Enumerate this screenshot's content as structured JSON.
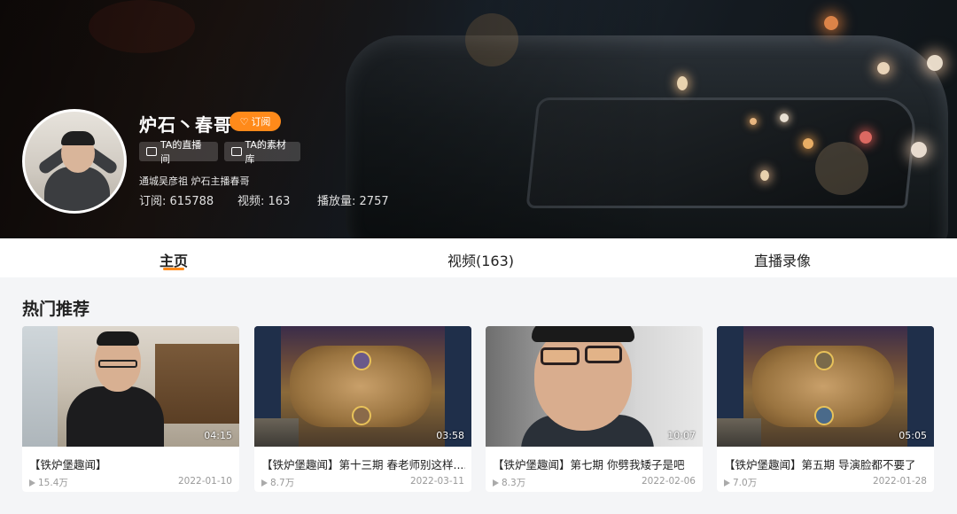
{
  "profile": {
    "name": "炉石丶春哥",
    "subscribe_label": "订阅",
    "live_room_label": "TA的直播间",
    "material_label": "TA的素材库",
    "description": "通城吴彦祖 炉石主播春哥",
    "stats": [
      {
        "label": "订阅:",
        "value": "615788"
      },
      {
        "label": "视频:",
        "value": "163"
      },
      {
        "label": "播放量:",
        "value": "2757"
      }
    ]
  },
  "tabs": [
    {
      "label": "主页",
      "active": true
    },
    {
      "label": "视频(163)",
      "active": false
    },
    {
      "label": "直播录像",
      "active": false
    }
  ],
  "section": {
    "title": "热门推荐"
  },
  "videos": [
    {
      "title": "【铁炉堡趣闻】",
      "duration": "04:15",
      "views": "15.4万",
      "date": "2022-01-10",
      "thumb": "face-room"
    },
    {
      "title": "【铁炉堡趣闻】第十三期 春老师别这样......",
      "duration": "03:58",
      "views": "8.7万",
      "date": "2022-03-11",
      "thumb": "hearthstone-board"
    },
    {
      "title": "【铁炉堡趣闻】第七期 你劈我矮子是吧",
      "duration": "10:07",
      "views": "8.3万",
      "date": "2022-02-06",
      "thumb": "face-closeup"
    },
    {
      "title": "【铁炉堡趣闻】第五期 导演脸都不要了",
      "duration": "05:05",
      "views": "7.0万",
      "date": "2022-01-28",
      "thumb": "hearthstone-board"
    }
  ],
  "colors": {
    "accent": "#ff8a1a",
    "page_bg": "#f4f5f7"
  }
}
